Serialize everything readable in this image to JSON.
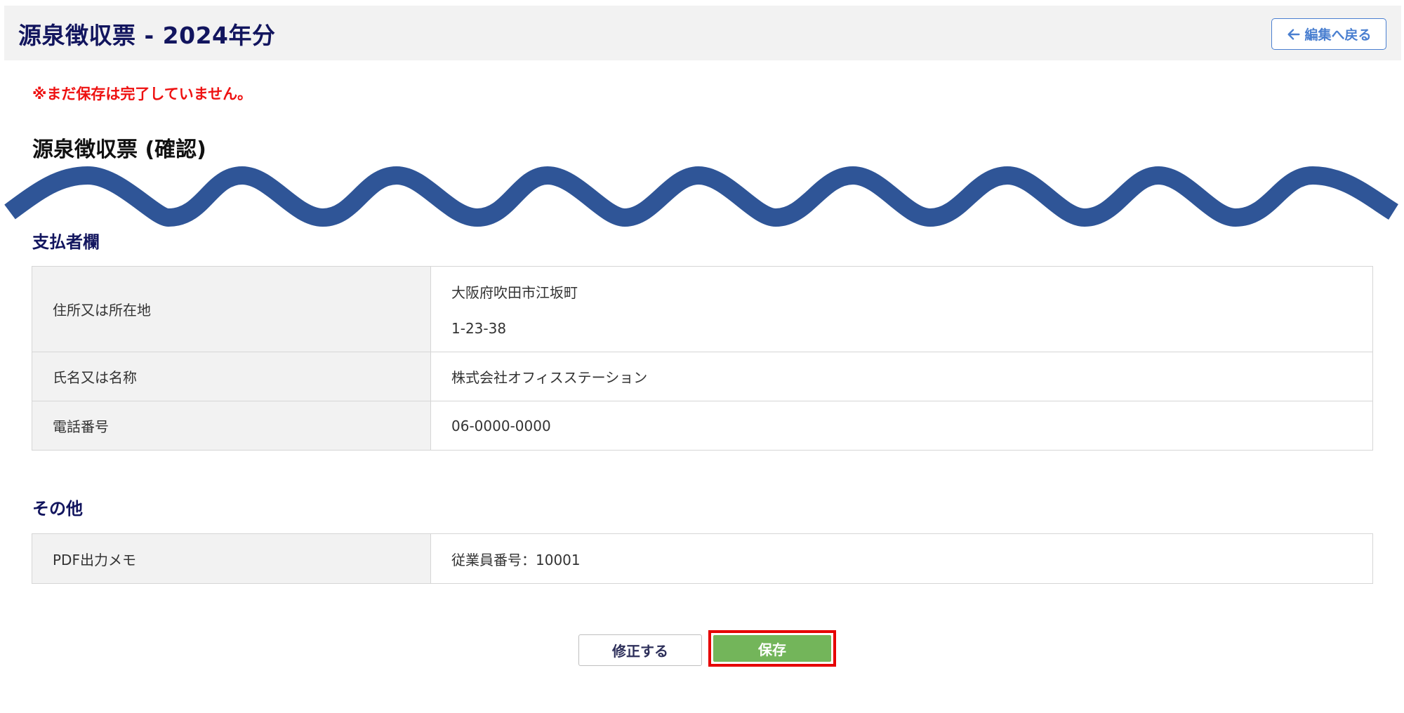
{
  "header": {
    "title": "源泉徴収票 - 2024年分",
    "back_label": "編集へ戻る"
  },
  "warning": "※まだ保存は完了していません。",
  "confirm_title": "源泉徴収票 (確認)",
  "payer_section": {
    "heading": "支払者欄",
    "rows": [
      {
        "label": "住所又は所在地",
        "value_line1": "大阪府吹田市江坂町",
        "value_line2": "1-23-38"
      },
      {
        "label": "氏名又は名称",
        "value": "株式会社オフィスステーション"
      },
      {
        "label": "電話番号",
        "value": "06-0000-0000"
      }
    ]
  },
  "other_section": {
    "heading": "その他",
    "rows": [
      {
        "label": "PDF出力メモ",
        "value": "従業員番号：10001"
      }
    ]
  },
  "actions": {
    "fix_label": "修正する",
    "save_label": "保存"
  },
  "colors": {
    "title_navy": "#12155e",
    "warning_red": "#ee1111",
    "wave_blue": "#2f5597",
    "save_green": "#73b55a",
    "highlight_red": "#e60000",
    "link_blue": "#4a7fd0"
  },
  "icons": {
    "back": "arrow-left-icon"
  }
}
